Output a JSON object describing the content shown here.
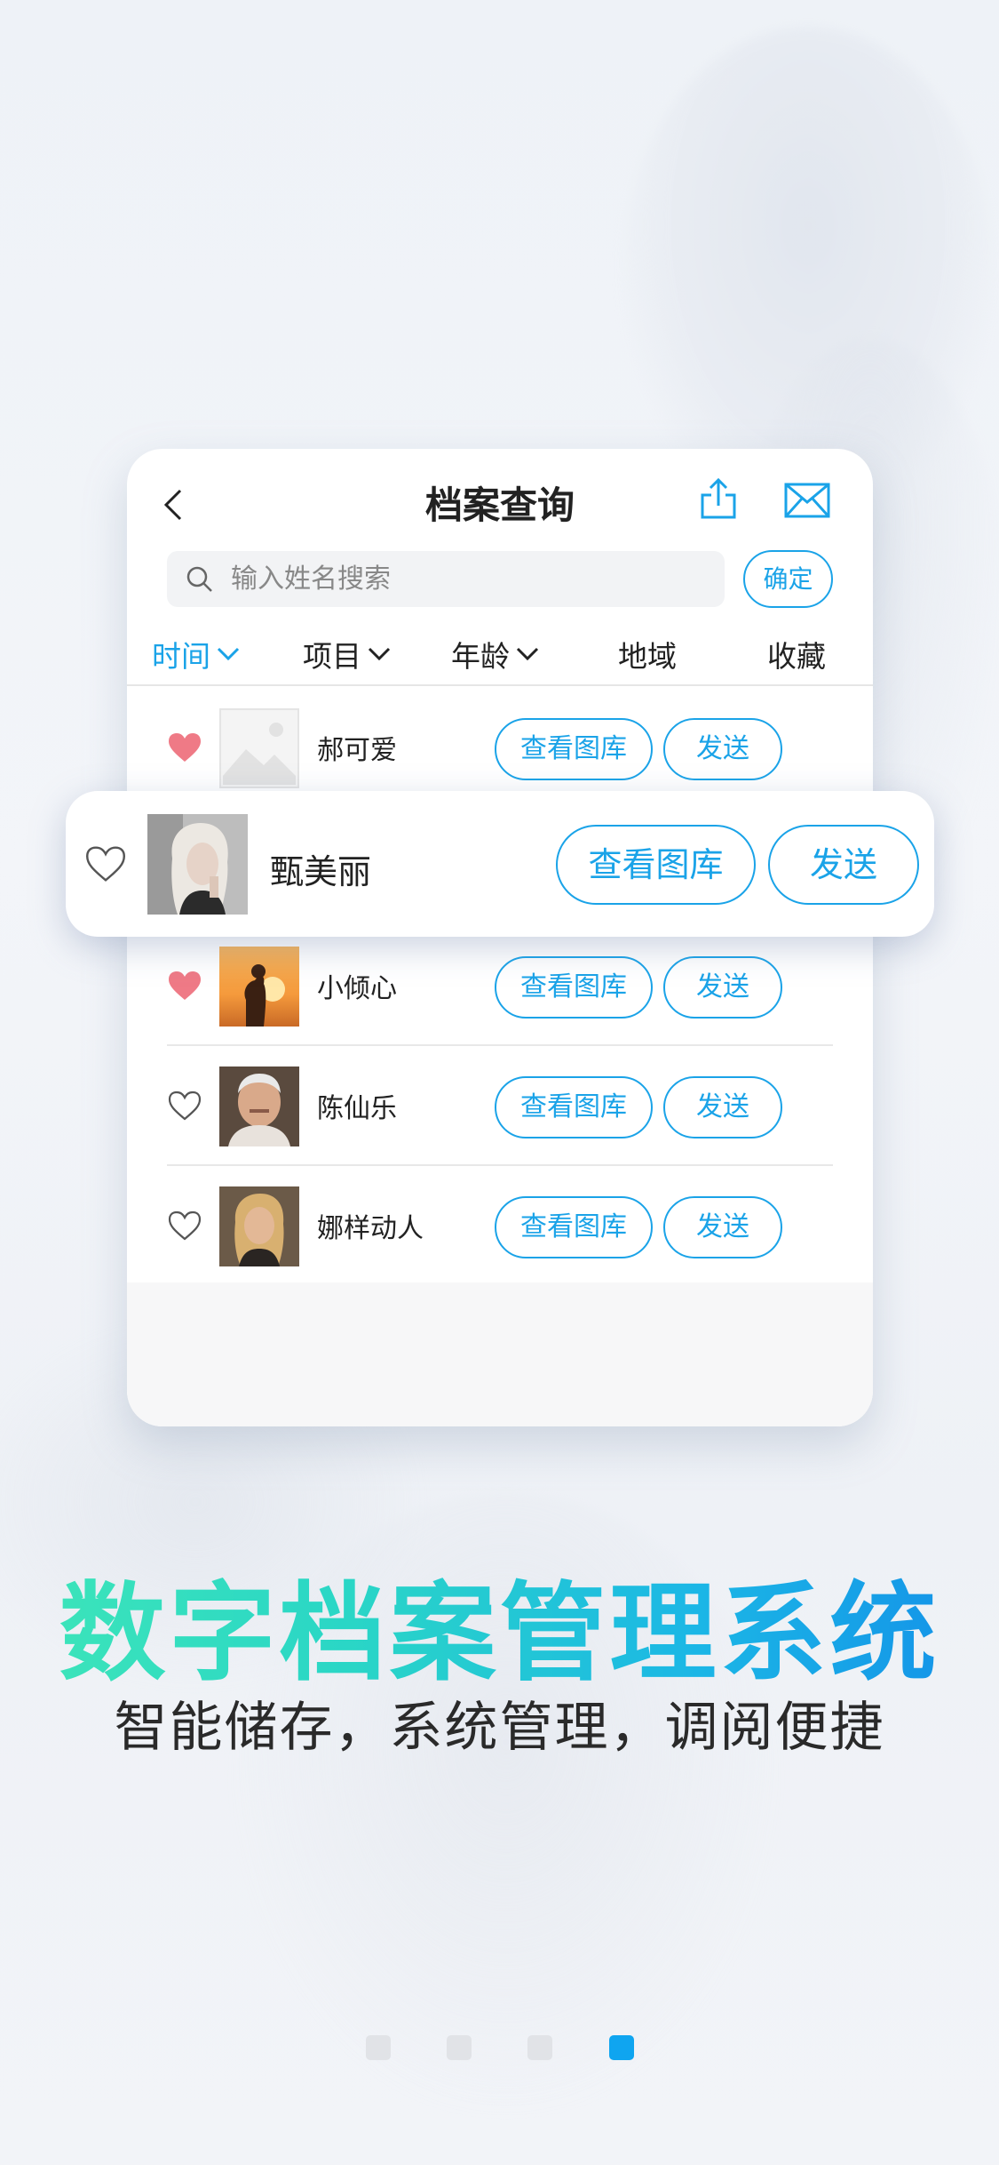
{
  "nav": {
    "title": "档案查询",
    "back_icon": "chevron-left-icon",
    "share_icon": "share-icon",
    "mail_icon": "mail-icon"
  },
  "search": {
    "placeholder": "输入姓名搜索",
    "confirm_label": "确定"
  },
  "filters": [
    {
      "label": "时间",
      "active": true,
      "has_dropdown": true
    },
    {
      "label": "项目",
      "active": false,
      "has_dropdown": true
    },
    {
      "label": "年龄",
      "active": false,
      "has_dropdown": true
    },
    {
      "label": "地域",
      "active": false,
      "has_dropdown": false
    },
    {
      "label": "收藏",
      "active": false,
      "has_dropdown": false
    }
  ],
  "rows": [
    {
      "name": "郝可爱",
      "favorited": true,
      "view_label": "查看图库",
      "send_label": "发送"
    },
    {
      "name": "甄美丽",
      "favorited": false,
      "view_label": "查看图库",
      "send_label": "发送"
    },
    {
      "name": "小倾心",
      "favorited": true,
      "view_label": "查看图库",
      "send_label": "发送"
    },
    {
      "name": "陈仙乐",
      "favorited": false,
      "view_label": "查看图库",
      "send_label": "发送"
    },
    {
      "name": "娜样动人",
      "favorited": false,
      "view_label": "查看图库",
      "send_label": "发送"
    }
  ],
  "headline": "数字档案管理系统",
  "subline": "智能储存，系统管理，调阅便捷",
  "pagination": {
    "count": 4,
    "active_index": 3
  },
  "colors": {
    "accent": "#1aa3e8",
    "heart_filled": "#ef7a86",
    "headline_start": "#3ee6b8",
    "headline_end": "#138fe8"
  }
}
